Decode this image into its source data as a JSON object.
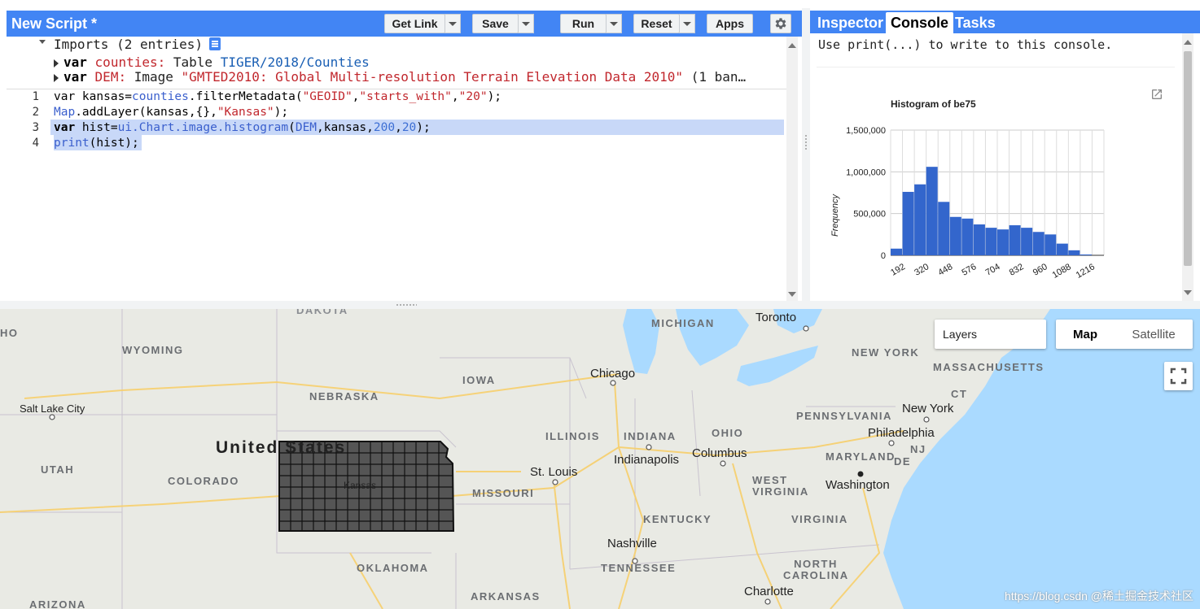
{
  "editor": {
    "title": "New Script *",
    "buttons": {
      "get_link": "Get Link",
      "save": "Save",
      "run": "Run",
      "reset": "Reset",
      "apps": "Apps"
    },
    "imports": {
      "header": "Imports (2 entries)",
      "entries": [
        {
          "keyword": "var",
          "name": "counties",
          "sep": ":",
          "type": "Table",
          "value": "TIGER/2018/Counties",
          "extra": ""
        },
        {
          "keyword": "var",
          "name": "DEM",
          "sep": ":",
          "type": "Image",
          "value": "\"GMTED2010: Global Multi-resolution Terrain Elevation Data 2010\"",
          "extra": "(1 ban…"
        }
      ]
    },
    "line_numbers": [
      "1",
      "2",
      "3",
      "4"
    ],
    "code": {
      "l1": {
        "a": "var kansas=",
        "b": "counties",
        "c": ".filterMetadata(",
        "d": "\"GEOID\"",
        "e": ",",
        "f": "\"starts_with\"",
        "g": ",",
        "h": "\"20\"",
        "i": ");"
      },
      "l2": {
        "a": "Map",
        "b": ".addLayer(kansas,{},",
        "c": "\"Kansas\"",
        "d": ");"
      },
      "l3": {
        "a": "var",
        "b": " hist=",
        "c": "ui.Chart.image.histogram",
        "d": "(",
        "e": "DEM",
        "f": ",kansas,",
        "g": "200",
        "h": ",",
        "i": "20",
        "j": ");"
      },
      "l4": {
        "a": "print",
        "b": "(hist);"
      }
    }
  },
  "console_panel": {
    "tabs": [
      "Inspector",
      "Console",
      "Tasks"
    ],
    "active_tab": "Console",
    "message": "Use print(...) to write to this console."
  },
  "chart_data": {
    "type": "bar",
    "title": "Histogram of be75",
    "xlabel": "",
    "ylabel": "Frequency",
    "ylim": [
      0,
      1500000
    ],
    "y_ticks": [
      "0",
      "500,000",
      "1,000,000",
      "1,500,000"
    ],
    "x_tick_labels": [
      "192",
      "320",
      "448",
      "576",
      "704",
      "832",
      "960",
      "1088",
      "1216"
    ],
    "bin_width": 64,
    "bin_starts": [
      128,
      192,
      256,
      320,
      384,
      448,
      512,
      576,
      640,
      704,
      768,
      832,
      896,
      960,
      1024,
      1088,
      1152,
      1216
    ],
    "values": [
      80000,
      760000,
      850000,
      1060000,
      640000,
      460000,
      440000,
      370000,
      330000,
      310000,
      360000,
      330000,
      280000,
      250000,
      140000,
      60000,
      10000,
      0
    ],
    "color": "#3366cc",
    "grid": true
  },
  "map": {
    "layers_label": "Layers",
    "map_type_buttons": [
      "Map",
      "Satellite"
    ],
    "active_map_type": "Map",
    "kansas_label": "Kansas",
    "labels": {
      "states": [
        "WYOMING",
        "NEBRASKA",
        "IOWA",
        "UTAH",
        "COLORADO",
        "MISSOURI",
        "ILLINOIS",
        "INDIANA",
        "OHIO",
        "KENTUCKY",
        "WEST VIRGINIA",
        "VIRGINIA",
        "TENNESSEE",
        "NORTH CAROLINA",
        "OKLAHOMA",
        "ARKANSAS",
        "ARIZONA",
        "MICHIGAN",
        "NEW YORK",
        "MASSACHUSETTS",
        "PENNSYLVANIA",
        "MARYLAND",
        "NJ",
        "CT",
        "DE",
        "DAKOTA",
        "HO"
      ],
      "cities": [
        "Toronto",
        "Chicago",
        "Salt Lake City",
        "New York",
        "Philadelphia",
        "Columbus",
        "Indianapolis",
        "St. Louis",
        "Washington",
        "Nashville",
        "Charlotte"
      ],
      "country": "United States"
    },
    "watermark": "https://blog.csdn @稀土掘金技术社区"
  }
}
